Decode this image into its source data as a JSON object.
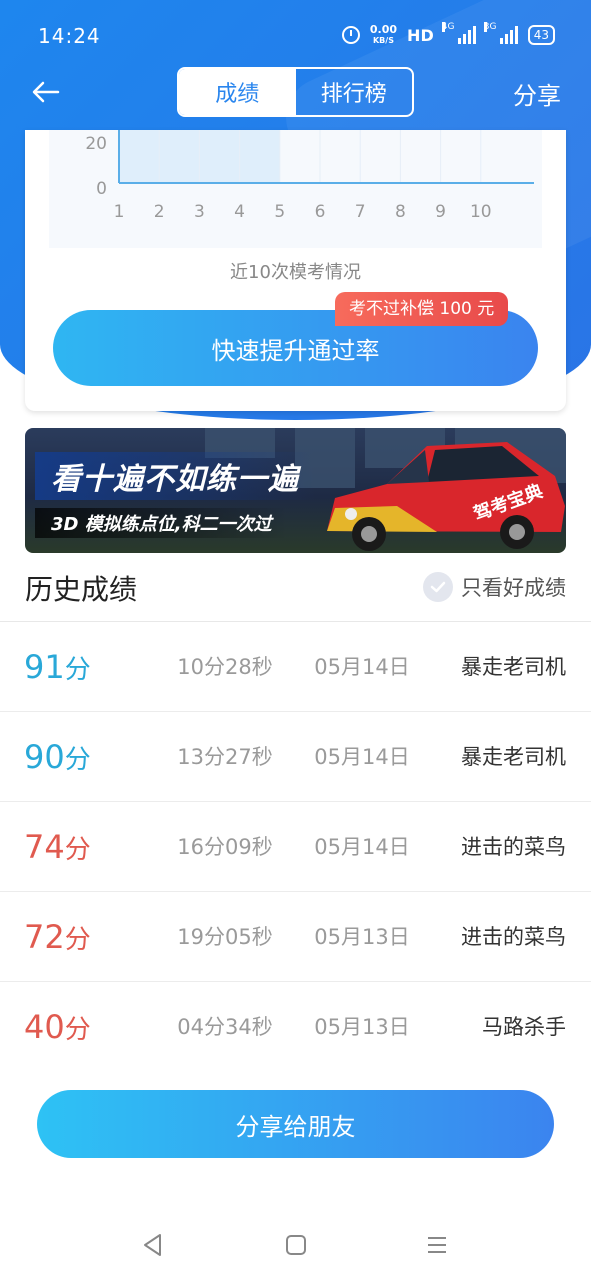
{
  "status_bar": {
    "time": "14:24",
    "speed_value": "0.00",
    "speed_unit": "KB/S",
    "hd_label": "HD",
    "signal1_label": "4G",
    "signal2_label": "3G",
    "battery": "43"
  },
  "nav": {
    "tabs": [
      {
        "label": "成绩",
        "active": true
      },
      {
        "label": "排行榜",
        "active": false
      }
    ],
    "share_label": "分享"
  },
  "chart_data": {
    "type": "area",
    "x": [
      1,
      2,
      3,
      4,
      5,
      6,
      7,
      8,
      9,
      10
    ],
    "y_ticks": [
      "20",
      "0"
    ],
    "x_ticks": [
      "1",
      "2",
      "3",
      "4",
      "5",
      "6",
      "7",
      "8",
      "9",
      "10"
    ],
    "highlight_range": [
      1,
      5
    ],
    "title": "近10次模考情况",
    "xlabel": "",
    "ylabel": ""
  },
  "promo": {
    "button_label": "快速提升通过率",
    "badge": "考不过补偿 100 元"
  },
  "banner": {
    "title": "看十遍不如练一遍",
    "subtitle": "3D 模拟练点位,科二一次过",
    "car_text": "驾考宝典"
  },
  "history": {
    "title": "历史成绩",
    "filter_label": "只看好成绩",
    "score_unit": "分",
    "rows": [
      {
        "score": "91",
        "duration": "10分28秒",
        "date": "05月14日",
        "rank": "暴走老司机",
        "status": "good"
      },
      {
        "score": "90",
        "duration": "13分27秒",
        "date": "05月14日",
        "rank": "暴走老司机",
        "status": "good"
      },
      {
        "score": "74",
        "duration": "16分09秒",
        "date": "05月14日",
        "rank": "进击的菜鸟",
        "status": "bad"
      },
      {
        "score": "72",
        "duration": "19分05秒",
        "date": "05月13日",
        "rank": "进击的菜鸟",
        "status": "bad"
      },
      {
        "score": "40",
        "duration": "04分34秒",
        "date": "05月13日",
        "rank": "马路杀手",
        "status": "bad"
      }
    ]
  },
  "share_friends_label": "分享给朋友",
  "colors": {
    "primary_blue": "#2a86ee",
    "good_score": "#29a8d8",
    "bad_score": "#e05a4f",
    "badge_red": "#e84a4a"
  }
}
